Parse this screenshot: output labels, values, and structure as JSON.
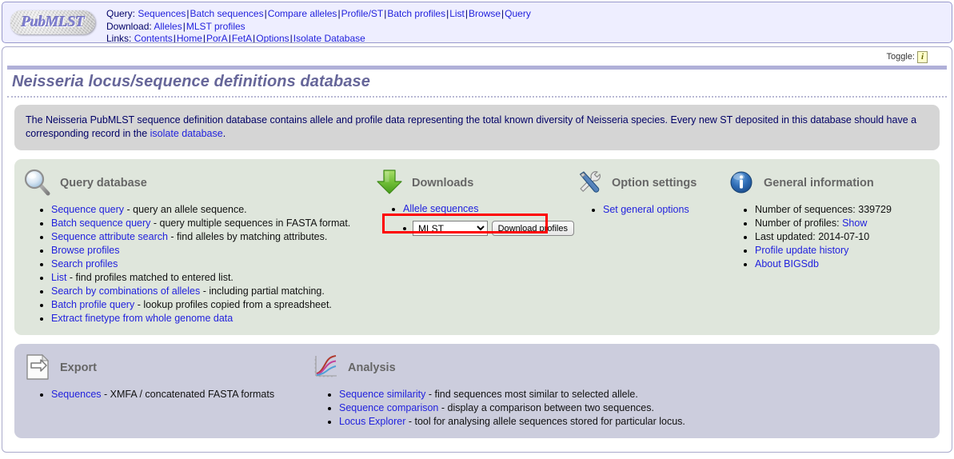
{
  "header": {
    "logo_text": "PubMLST",
    "rows": [
      {
        "label": "Query:",
        "links": [
          "Sequences",
          "Batch sequences",
          "Compare alleles",
          "Profile/ST",
          "Batch profiles",
          "List",
          "Browse",
          "Query"
        ]
      },
      {
        "label": "Download:",
        "links": [
          "Alleles",
          "MLST profiles"
        ]
      },
      {
        "label": "Links:",
        "links": [
          "Contents",
          "Home",
          "PorA",
          "FetA",
          "Options",
          "Isolate Database"
        ]
      }
    ]
  },
  "toggle": {
    "label": "Toggle:",
    "icon_letter": "i"
  },
  "page_title": "Neisseria locus/sequence definitions database",
  "description": {
    "part1": "The Neisseria PubMLST sequence definition database contains allele and profile data representing the total known diversity of Neisseria species. Every new ST deposited in this database should have a corresponding record in the ",
    "link": "isolate database",
    "part2": "."
  },
  "query_database": {
    "title": "Query database",
    "icon": "magnifier-icon",
    "items": [
      {
        "link": "Sequence query",
        "text": " - query an allele sequence."
      },
      {
        "link": "Batch sequence query",
        "text": " - query multiple sequences in FASTA format."
      },
      {
        "link": "Sequence attribute search",
        "text": " - find alleles by matching attributes."
      },
      {
        "link": "Browse profiles",
        "text": ""
      },
      {
        "link": "Search profiles",
        "text": ""
      },
      {
        "link": "List",
        "text": " - find profiles matched to entered list."
      },
      {
        "link": "Search by combinations of alleles",
        "text": " - including partial matching."
      },
      {
        "link": "Batch profile query",
        "text": " - lookup profiles copied from a spreadsheet."
      },
      {
        "link": "Extract finetype from whole genome data",
        "text": ""
      }
    ]
  },
  "downloads": {
    "title": "Downloads",
    "icon": "green-down-arrow-icon",
    "allele_link": "Allele sequences",
    "select_value": "MLST",
    "select_options": [
      "MLST"
    ],
    "button_label": "Download profiles",
    "highlight_color": "#ff0000"
  },
  "option_settings": {
    "title": "Option settings",
    "icon": "tools-icon",
    "items": [
      {
        "link": "Set general options",
        "text": ""
      }
    ]
  },
  "general_information": {
    "title": "General information",
    "icon": "info-circle-icon",
    "items": [
      {
        "pre": "Number of sequences: ",
        "value": "339729",
        "link": ""
      },
      {
        "pre": "Number of profiles: ",
        "value": "",
        "link": "Show"
      },
      {
        "pre": "Last updated: ",
        "value": "2014-07-10",
        "link": ""
      },
      {
        "pre": "",
        "value": "",
        "link": "Profile update history"
      },
      {
        "pre": "",
        "value": "",
        "link": "About BIGSdb"
      }
    ]
  },
  "export": {
    "title": "Export",
    "icon": "document-arrow-icon",
    "items": [
      {
        "link": "Sequences",
        "text": " - XMFA / concatenated FASTA formats"
      }
    ]
  },
  "analysis": {
    "title": "Analysis",
    "icon": "line-chart-icon",
    "items": [
      {
        "link": "Sequence similarity",
        "text": " - find sequences most similar to selected allele."
      },
      {
        "link": "Sequence comparison",
        "text": " - display a comparison between two sequences."
      },
      {
        "link": "Locus Explorer",
        "text": " - tool for analysing allele sequences stored for particular locus."
      }
    ]
  }
}
